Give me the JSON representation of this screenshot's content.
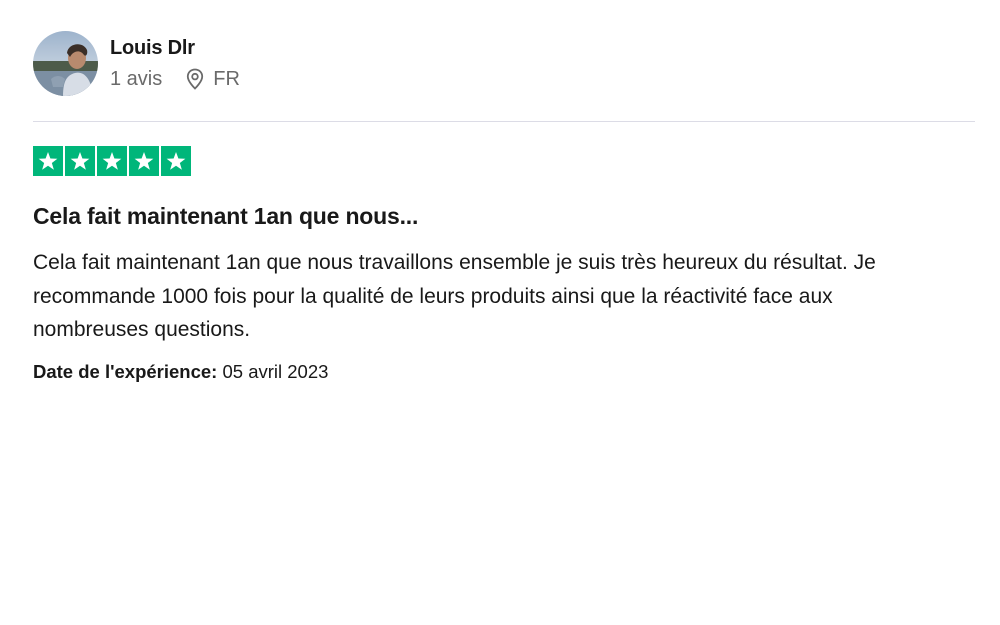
{
  "consumer": {
    "name": "Louis Dlr",
    "reviews_count": "1 avis",
    "country": "FR",
    "avatar_icon": "user-photo-avatar"
  },
  "rating": {
    "stars": 5,
    "max": 5,
    "color": "#00b67a",
    "icon": "star-icon"
  },
  "review": {
    "title": "Cela fait maintenant 1an que nous...",
    "text": "Cela fait maintenant 1an que nous travaillons ensemble je suis très heureux du résultat. Je recommande 1000 fois pour la qualité de leurs produits ainsi que la réactivité face aux nombreuses questions.",
    "date_label": "Date de l'expérience:",
    "date_value": "05 avril 2023"
  },
  "icons": {
    "location": "location-pin-icon"
  }
}
